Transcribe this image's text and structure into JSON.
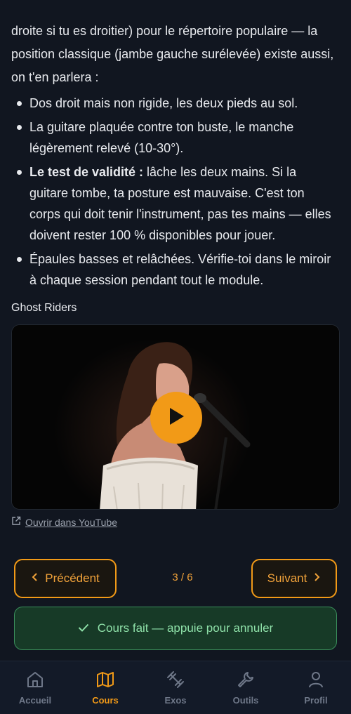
{
  "lesson": {
    "intro_partial": "(, ) , …",
    "intro": "droite si tu es droitier) pour le répertoire populaire — la position classique (jambe gauche surélevée) existe aussi, on t'en parlera :",
    "bullets": [
      {
        "bold": "",
        "text": "Dos droit mais non rigide, les deux pieds au sol."
      },
      {
        "bold": "",
        "text": "La guitare plaquée contre ton buste, le manche légèrement relevé (10-30°)."
      },
      {
        "bold": "Le test de validité :",
        "text": " lâche les deux mains. Si la guitare tombe, ta posture est mauvaise. C'est ton corps qui doit tenir l'instrument, pas tes mains — elles doivent rester 100 % disponibles pour jouer."
      },
      {
        "bold": "",
        "text": "Épaules basses et relâchées. Vérifie-toi dans le miroir à chaque session pendant tout le module."
      }
    ]
  },
  "video": {
    "title": "Ghost Riders",
    "youtube_link": "Ouvrir dans YouTube",
    "icons": {
      "play": "play-icon",
      "external": "external-link-icon"
    }
  },
  "pager": {
    "prev_label": "Précédent",
    "next_label": "Suivant",
    "indicator": "3 / 6"
  },
  "status": {
    "done_label": "Cours fait — appuie pour annuler"
  },
  "bottom_nav": [
    {
      "label": "Accueil",
      "icon": "home-icon",
      "active": false
    },
    {
      "label": "Cours",
      "icon": "map-icon",
      "active": true
    },
    {
      "label": "Exos",
      "icon": "dumbbell-icon",
      "active": false
    },
    {
      "label": "Outils",
      "icon": "wrench-icon",
      "active": false
    },
    {
      "label": "Profil",
      "icon": "user-icon",
      "active": false
    }
  ],
  "colors": {
    "accent": "#f29a17",
    "background": "#111620",
    "success": "#8ee0a8"
  }
}
